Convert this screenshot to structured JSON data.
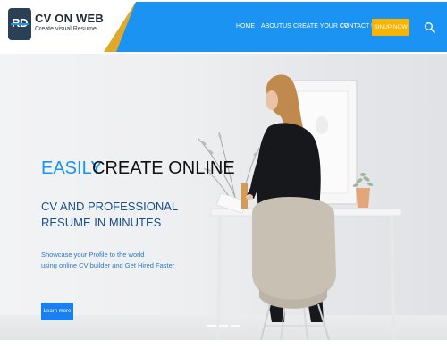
{
  "brand": {
    "logo_letters": "RD",
    "name": "CV ON WEB",
    "tagline": "Create visual Resume"
  },
  "nav": {
    "items": [
      {
        "label": "HOME"
      },
      {
        "label": "ABOUTUS"
      },
      {
        "label": "CREATE YOUR CV"
      },
      {
        "label": "CONTACT US"
      }
    ],
    "signup_label": "SINUP NOW",
    "search_icon": "search-icon"
  },
  "hero": {
    "title_accent": "EASILY",
    "title_rest": "CREATE ONLINE",
    "subtitle_line1": "CV AND PROFESSIONAL",
    "subtitle_line2": "RESUME IN MINUTES",
    "desc_line1": "Showcase your Profile to the world",
    "desc_line2": "using online CV builder and Get Hired Faster",
    "cta_label": "Learn more",
    "slides": 3
  },
  "colors": {
    "accent": "#1a93f2",
    "gold": "#e0a92c",
    "signup": "#f8b400",
    "button": "#1a7ff0"
  }
}
